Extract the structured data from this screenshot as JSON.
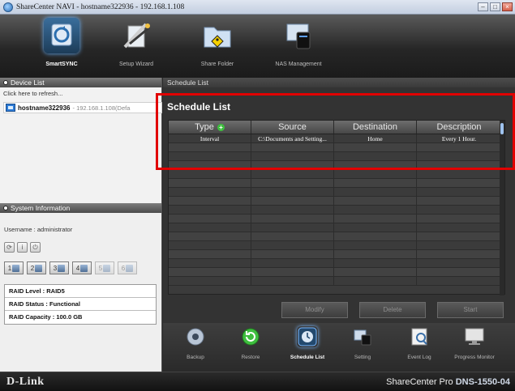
{
  "window": {
    "title": "ShareCenter NAVI - hostname322936 - 192.168.1.108",
    "min_glyph": "–",
    "max_glyph": "□",
    "close_glyph": "×"
  },
  "toolbar": {
    "items": [
      {
        "label": "SmartSYNC",
        "icon": "smartsync-icon",
        "active": true
      },
      {
        "label": "Setup Wizard",
        "icon": "setup-wizard-icon"
      },
      {
        "label": "Share Folder",
        "icon": "share-folder-icon"
      },
      {
        "label": "NAS Management",
        "icon": "nas-management-icon"
      }
    ]
  },
  "device_list": {
    "header": "Device List",
    "refresh": "Click here to refresh...",
    "device": {
      "name": "hostname322936",
      "ip": "- 192.168.1.108(Defa"
    }
  },
  "system_info": {
    "header": "System Information",
    "username": "Username : administrator",
    "icons": [
      "sync-icon",
      "info-icon",
      "power-icon"
    ],
    "disks": [
      "1",
      "2",
      "3",
      "4",
      "5",
      "6"
    ],
    "raid_level": "RAID Level : RAID5",
    "raid_status": "RAID Status : Functional",
    "raid_capacity": "RAID Capacity : 100.0 GB"
  },
  "main": {
    "breadcrumb": "Schedule List",
    "heading": "Schedule List",
    "columns": [
      "Type",
      "Source",
      "Destination",
      "Description"
    ],
    "rows": [
      [
        "Interval",
        "C:\\Documents and Setting...",
        "Home",
        "Every 1 Hour."
      ]
    ],
    "buttons": {
      "modify": "Modify",
      "delete": "Delete",
      "start": "Start"
    }
  },
  "bottom_tools": [
    {
      "label": "Backup",
      "icon": "backup-icon"
    },
    {
      "label": "Restore",
      "icon": "restore-icon"
    },
    {
      "label": "Schedule List",
      "icon": "schedule-list-icon",
      "active": true
    },
    {
      "label": "Setting",
      "icon": "setting-icon"
    },
    {
      "label": "Event Log",
      "icon": "event-log-icon"
    },
    {
      "label": "Progress Monitor",
      "icon": "progress-monitor-icon"
    }
  ],
  "footer": {
    "brand": "D-Link",
    "product": "ShareCenter Pro",
    "model": "DNS-1550-04"
  },
  "colors": {
    "highlight": "#e10000",
    "accent_blue": "#2e7bd6",
    "add_green": "#3fbf3f"
  }
}
